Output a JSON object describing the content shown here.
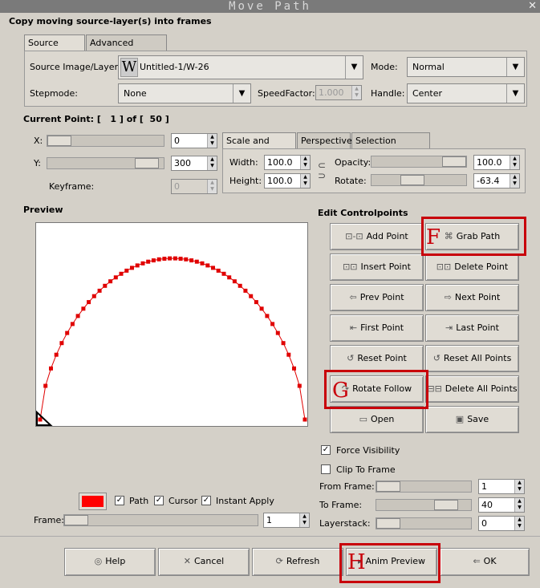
{
  "window": {
    "title": "Move Path",
    "close_glyph": "✕",
    "subtitle": "Copy moving source-layer(s) into frames"
  },
  "tabs": [
    {
      "label": "Source Select"
    },
    {
      "label": "Advanced Settings"
    }
  ],
  "source": {
    "layer_label": "Source Image/Layer:",
    "layer_value": "Untitled-1/W-26",
    "layer_thumb": "W",
    "mode_label": "Mode:",
    "mode_value": "Normal",
    "stepmode_label": "Stepmode:",
    "stepmode_value": "None",
    "speed_label": "SpeedFactor:",
    "speed_value": "1.000",
    "handle_label": "Handle:",
    "handle_value": "Center"
  },
  "current_point": "Current Point: [   1 ] of [  50 ]",
  "point": {
    "x_label": "X:",
    "x_value": "0",
    "x_fraction": 0.0,
    "y_label": "Y:",
    "y_value": "300",
    "y_fraction": 0.95,
    "keyframe_label": "Keyframe:",
    "keyframe_value": "0"
  },
  "modify_tabs": [
    {
      "label": "Scale and Modify"
    },
    {
      "label": "Perspective"
    },
    {
      "label": "Selection Handling"
    }
  ],
  "modify": {
    "width_label": "Width:",
    "width_value": "100.0",
    "height_label": "Height:",
    "height_value": "100.0",
    "opacity_label": "Opacity:",
    "opacity_value": "100.0",
    "rotate_label": "Rotate:",
    "rotate_value": "-63.4"
  },
  "preview_label": "Preview",
  "edit_label": "Edit Controlpoints",
  "buttons": {
    "add_point": "Add Point",
    "grab_path": "Grab Path",
    "insert_point": "Insert Point",
    "delete_point": "Delete Point",
    "prev_point": "Prev Point",
    "next_point": "Next Point",
    "first_point": "First Point",
    "last_point": "Last Point",
    "reset_point": "Reset Point",
    "reset_all": "Reset All Points",
    "rotate_follow": "Rotate Follow",
    "delete_all": "Delete All Points",
    "open": "Open",
    "save": "Save",
    "help": "Help",
    "cancel": "Cancel",
    "refresh": "Refresh",
    "anim_preview": "Anim Preview",
    "ok": "OK"
  },
  "markers": {
    "f": "F",
    "g": "G",
    "h": "H"
  },
  "options": {
    "force_visibility": "Force Visibility",
    "force_checked": true,
    "clip_to_frame": "Clip To Frame",
    "clip_checked": false
  },
  "range": {
    "from_label": "From Frame:",
    "from_value": "1",
    "to_label": "To Frame:",
    "to_value": "40",
    "layerstack_label": "Layerstack:",
    "layerstack_value": "0"
  },
  "preview_opts": {
    "path": "Path",
    "cursor": "Cursor",
    "instant": "Instant Apply",
    "frame_label": "Frame:",
    "frame_value": "1",
    "swatch_color": "#ff0000"
  },
  "colors": {
    "highlight": "#c8000a",
    "path": "#e00000"
  },
  "check_glyph": "✓"
}
